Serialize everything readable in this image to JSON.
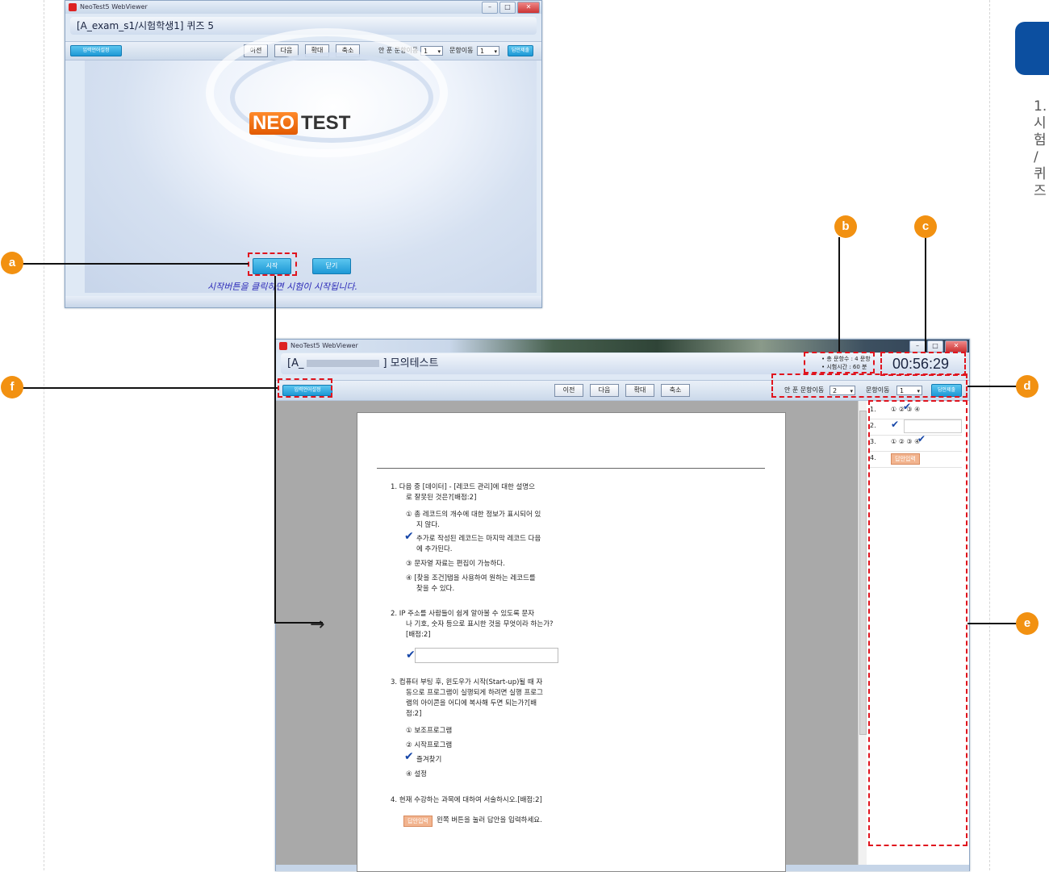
{
  "login_window": {
    "app_title": "NeoTest5 WebViewer",
    "exam_title": "[A_exam_s1/시험학생1] 퀴즈 5",
    "input_lang_button": "입력언어설정",
    "toolbar": {
      "prev": "이전",
      "next": "다음",
      "zoom_in": "확대",
      "zoom_out": "축소"
    },
    "unanswered_label": "안 푼 문항이동",
    "unanswered_value": "1",
    "goto_label": "문항이동",
    "goto_value": "1",
    "submit_button": "답안제출",
    "logo_part1": "NEO",
    "logo_part2": "TEST",
    "start_button": "시작",
    "close_button": "닫기",
    "instruction": "시작버튼을 클릭하면 시험이 시작됩니다."
  },
  "exam_window": {
    "app_title": "NeoTest5 WebViewer",
    "exam_title_prefix": "[A_",
    "exam_title_suffix": "] 모의테스트",
    "info_total": "• 총 문항수 : 4 문항",
    "info_time": "• 시험시간 : 60 분",
    "timer": "00:56:29",
    "input_lang_button": "입력언어설정",
    "toolbar": {
      "prev": "이전",
      "next": "다음",
      "zoom_in": "확대",
      "zoom_out": "축소"
    },
    "unanswered_label": "안 푼 문항이동",
    "unanswered_value": "2",
    "goto_label": "문항이동",
    "goto_value": "1",
    "submit_button": "답안제출",
    "questions": {
      "q1_l1": "1.  다음 중 [데이터] - [레코드 관리]에 대한 설명으",
      "q1_l2": "로 잘못된 것은?[배점:2]",
      "q1_o1a": "① 총 레코드의 개수에 대한 정보가 표시되어 있",
      "q1_o1b": "지 않다.",
      "q1_o2a": "추가로 작성된 레코드는 마지막 레코드 다음",
      "q1_o2b": "에 추가된다.",
      "q1_o3": "③ 문자열 자료는 편집이 가능하다.",
      "q1_o4a": "④ [찾을 조건]탭을 사용하여 원하는 레코드를",
      "q1_o4b": "찾을 수 있다.",
      "q2_l1": "2.  IP 주소를 사람들이 쉽게 알아볼 수 있도록 문자",
      "q2_l2": "나 기호, 숫자 등으로 표시한 것을 무엇이라 하는가?",
      "q2_l3": "[배점:2]",
      "q3_l1": "3.  컴퓨터 부팅 후, 윈도우가 시작(Start-up)될 때 자",
      "q3_l2": "동으로 프로그램이 실행되게 하려면 실행 프로그",
      "q3_l3": "램의 아이콘을 어디에 복사해 두면 되는가?[배",
      "q3_l4": "점:2]",
      "q3_o1": "① 보조프로그램",
      "q3_o2": "② 시작프로그램",
      "q3_o3": "즐겨찾기",
      "q3_o4": "④ 설정",
      "q4_l1": "4.  현재 수강하는 과목에 대하여 서술하시오.[배점:2]",
      "q4_btn": "답안입력",
      "q4_hint": "왼쪽 버튼을 눌러 답안을 입력하세요."
    },
    "answer_panel": {
      "row1_num": "1.",
      "row1_opts": "①  ②  ③  ④",
      "row2_num": "2.",
      "row3_num": "3.",
      "row3_opts": "①  ②  ③  ④",
      "row4_num": "4.",
      "row4_btn": "답안입력"
    }
  },
  "callouts": {
    "a": "a",
    "b": "b",
    "c": "c",
    "d": "d",
    "e": "e",
    "f": "f"
  },
  "side_panel": {
    "lines": [
      "1.",
      "시",
      "험",
      "/",
      "퀴",
      "즈"
    ]
  },
  "colors": {
    "accent_orange": "#f29111",
    "highlight_red": "#e0141e",
    "side_tab_blue": "#0c4fa0"
  }
}
